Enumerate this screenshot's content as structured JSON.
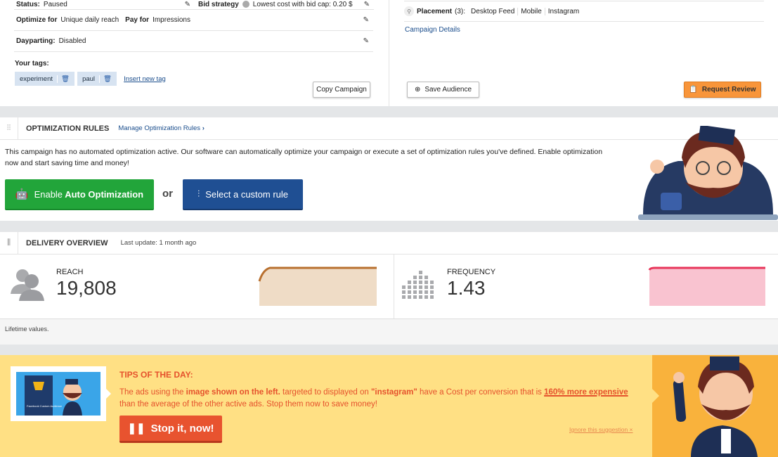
{
  "campaign": {
    "status_label": "Status:",
    "status_value": "Paused",
    "bid_strategy_label": "Bid strategy",
    "bid_strategy_value": "Lowest cost with bid cap: 0.20 $",
    "optimize_for_label": "Optimize for",
    "optimize_for_value": "Unique daily reach",
    "pay_for_label": "Pay for",
    "pay_for_value": "Impressions",
    "dayparting_label": "Dayparting:",
    "dayparting_value": "Disabled",
    "tags_label": "Your tags:",
    "tags": [
      "experiment",
      "paul"
    ],
    "insert_tag": "Insert new tag",
    "copy_campaign": "Copy Campaign",
    "placement_label": "Placement",
    "placement_count": "(3):",
    "placements": [
      "Desktop Feed",
      "Mobile",
      "Instagram"
    ],
    "campaign_details": "Campaign Details",
    "save_audience": "Save Audience",
    "request_review": "Request Review"
  },
  "optimization": {
    "title": "OPTIMIZATION RULES",
    "manage_link": "Manage Optimization Rules",
    "description": "This campaign has no automated optimization active. Our software can automatically optimize your campaign or execute a set of optimization rules you've defined. Enable optimization now and start saving time and money!",
    "enable_prefix": "Enable",
    "enable_bold": "Auto Optimization",
    "or": "or",
    "custom_rule": "Select a custom rule"
  },
  "delivery": {
    "title": "DELIVERY OVERVIEW",
    "last_update": "Last update: 1 month ago",
    "reach_label": "REACH",
    "reach_value": "19,808",
    "frequency_label": "FREQUENCY",
    "frequency_value": "1.43",
    "footer": "Lifetime values.",
    "reach_color": "#b8702f",
    "frequency_color": "#e8365a"
  },
  "tips": {
    "title": "TIPS OF THE DAY:",
    "text_1": "The ads using the ",
    "text_bold_1": "image shown on the left.",
    "text_2": " targeted to displayed on ",
    "text_bold_2": "\"instagram\"",
    "text_3": " have a Cost per conversion that is ",
    "text_highlight": "160% more expensive",
    "text_4": " than the average of the other active ads. Stop them now to save money!",
    "stop_button": "Stop it, now!",
    "ignore": "Ignore this suggestion ×",
    "image_caption": "Facebook Custom Audience"
  }
}
